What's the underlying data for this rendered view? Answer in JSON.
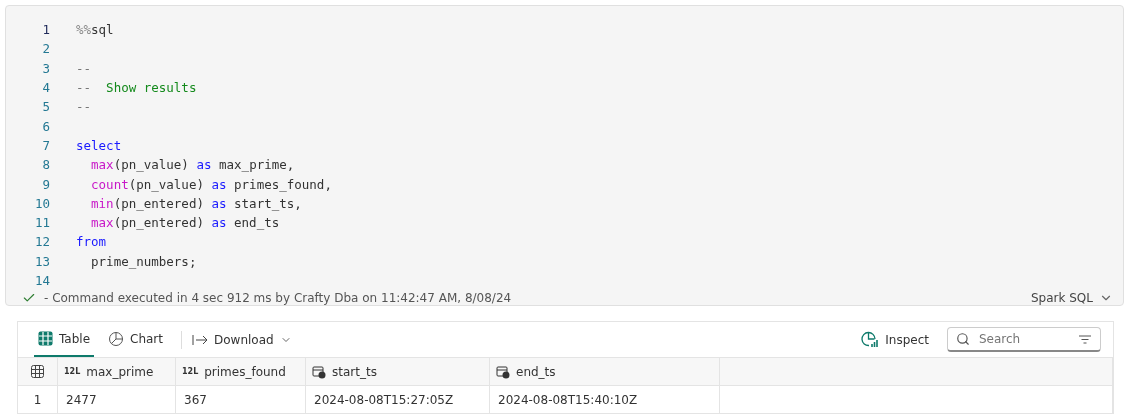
{
  "code_cell": {
    "lines": [
      {
        "number": "1",
        "current": true,
        "tokens": [
          {
            "kind": "magic",
            "text": "%%"
          },
          {
            "kind": "plain",
            "text": "sql"
          }
        ]
      },
      {
        "number": "2",
        "current": false
      },
      {
        "number": "3",
        "current": false,
        "tokens": [
          {
            "kind": "dash",
            "text": "--"
          }
        ]
      },
      {
        "number": "4",
        "current": false,
        "tokens": [
          {
            "kind": "dash",
            "text": "--"
          },
          {
            "kind": "comment",
            "text": "  Show results"
          }
        ]
      },
      {
        "number": "5",
        "current": false,
        "tokens": [
          {
            "kind": "dash",
            "text": "--"
          }
        ]
      },
      {
        "number": "6",
        "current": false
      },
      {
        "number": "7",
        "current": false,
        "tokens": [
          {
            "kind": "keyword",
            "text": "select"
          }
        ]
      },
      {
        "number": "8",
        "current": false,
        "tokens": [
          {
            "kind": "function",
            "text": "  max"
          },
          {
            "kind": "plain",
            "text": "(pn_value) "
          },
          {
            "kind": "keyword",
            "text": "as"
          },
          {
            "kind": "plain",
            "text": " max_prime,"
          }
        ]
      },
      {
        "number": "9",
        "current": false,
        "tokens": [
          {
            "kind": "function",
            "text": "  count"
          },
          {
            "kind": "plain",
            "text": "(pn_value) "
          },
          {
            "kind": "keyword",
            "text": "as"
          },
          {
            "kind": "plain",
            "text": " primes_found,"
          }
        ]
      },
      {
        "number": "10",
        "current": false,
        "tokens": [
          {
            "kind": "function",
            "text": "  min"
          },
          {
            "kind": "plain",
            "text": "(pn_entered) "
          },
          {
            "kind": "keyword",
            "text": "as"
          },
          {
            "kind": "plain",
            "text": " start_ts,"
          }
        ]
      },
      {
        "number": "11",
        "current": false,
        "tokens": [
          {
            "kind": "function",
            "text": "  max"
          },
          {
            "kind": "plain",
            "text": "(pn_entered) "
          },
          {
            "kind": "keyword",
            "text": "as"
          },
          {
            "kind": "plain",
            "text": " end_ts"
          }
        ]
      },
      {
        "number": "12",
        "current": false,
        "tokens": [
          {
            "kind": "keyword",
            "text": "from"
          }
        ]
      },
      {
        "number": "13",
        "current": false,
        "tokens": [
          {
            "kind": "plain",
            "text": "  prime_numbers;"
          }
        ]
      },
      {
        "number": "14",
        "current": false
      }
    ],
    "status": {
      "succeeded": true,
      "text": "- Command executed in 4 sec 912 ms by Crafty Dba on 11:42:47 AM, 8/08/24"
    },
    "language": "Spark SQL"
  },
  "results": {
    "tabs": [
      {
        "label": "Table",
        "selected": true
      },
      {
        "label": "Chart",
        "selected": false
      }
    ],
    "download": "Download",
    "inspect": "Inspect",
    "search": {
      "placeholder": "Search"
    },
    "table": {
      "columns": [
        {
          "name": "max_prime",
          "kind": "number",
          "type_label": "12L"
        },
        {
          "name": "primes_found",
          "kind": "number",
          "type_label": "12L"
        },
        {
          "name": "start_ts",
          "kind": "timestamp"
        },
        {
          "name": "end_ts",
          "kind": "timestamp"
        }
      ],
      "rows": [
        {
          "index": "1",
          "cells": [
            "2477",
            "367",
            "2024-08-08T15:27:05Z",
            "2024-08-08T15:40:10Z"
          ]
        }
      ]
    }
  }
}
